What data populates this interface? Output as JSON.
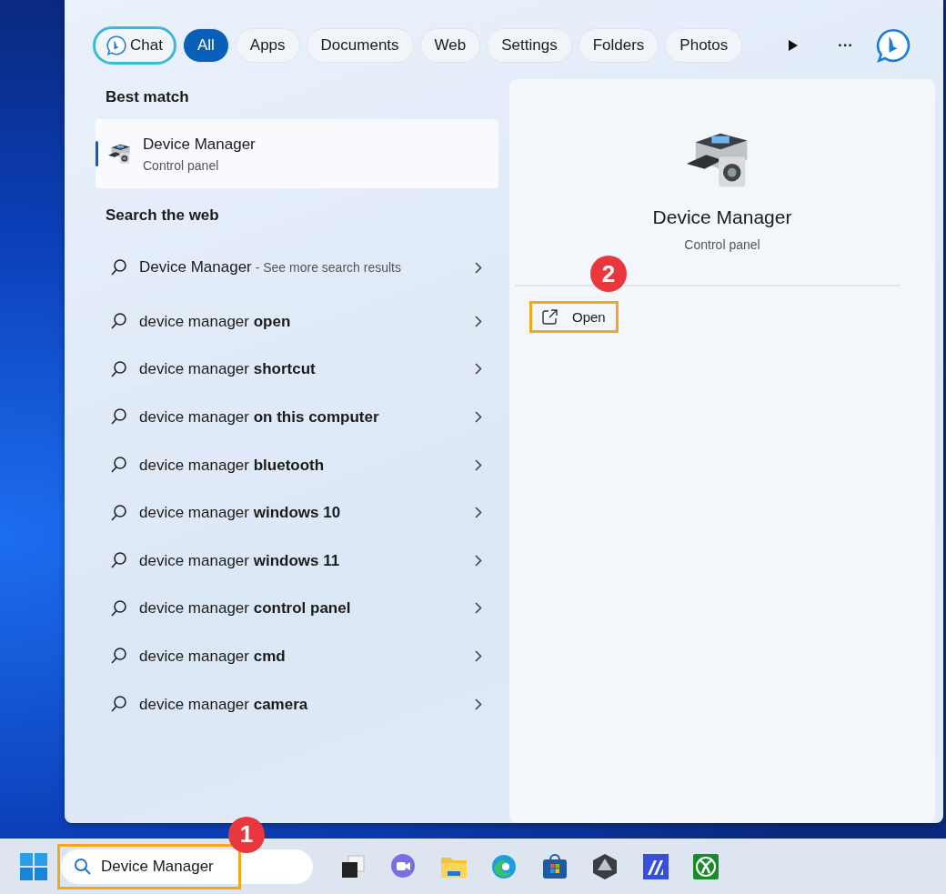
{
  "filters": [
    {
      "label": "Chat",
      "kind": "chat",
      "selected": false
    },
    {
      "label": "All",
      "kind": "plain",
      "selected": true
    },
    {
      "label": "Apps",
      "kind": "plain",
      "selected": false
    },
    {
      "label": "Documents",
      "kind": "plain",
      "selected": false
    },
    {
      "label": "Web",
      "kind": "plain",
      "selected": false
    },
    {
      "label": "Settings",
      "kind": "plain",
      "selected": false
    },
    {
      "label": "Folders",
      "kind": "plain",
      "selected": false
    },
    {
      "label": "Photos",
      "kind": "plain",
      "selected": false
    }
  ],
  "more_label": "···",
  "best_match": {
    "heading": "Best match",
    "title": "Device Manager",
    "subtitle": "Control panel",
    "selected": true
  },
  "web": {
    "heading": "Search the web",
    "results": [
      {
        "text": "Device Manager",
        "suffix": "- See more search results"
      },
      {
        "text": "device manager **open**"
      },
      {
        "text": "device manager **shortcut**"
      },
      {
        "text": "device manager **on this computer**"
      },
      {
        "text": "device manager **bluetooth**"
      },
      {
        "text": "device manager **windows 10**"
      },
      {
        "text": "device manager **windows 11**"
      },
      {
        "text": "device manager **control panel**"
      },
      {
        "text": "device manager **cmd**"
      },
      {
        "text": "device manager **camera**"
      }
    ]
  },
  "preview": {
    "title": "Device Manager",
    "subtitle": "Control panel",
    "actions": [
      {
        "label": "Open",
        "badge": "2"
      }
    ]
  },
  "taskbar": {
    "search": {
      "value": "Device Manager",
      "badge": "1"
    }
  }
}
